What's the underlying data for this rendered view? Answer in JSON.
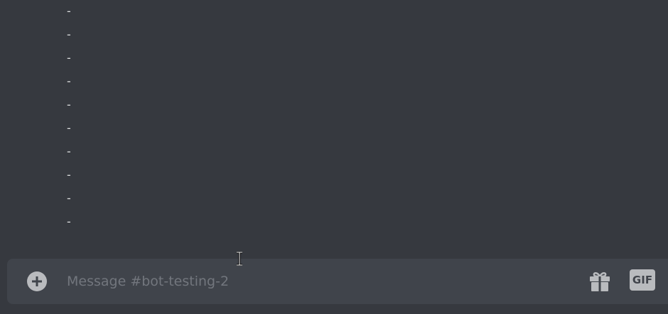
{
  "messages": {
    "lines": [
      "-",
      "-",
      "-",
      "-",
      "-",
      "-",
      "-",
      "-",
      "-",
      "-"
    ]
  },
  "composer": {
    "placeholder": "Message #bot-testing-2",
    "value": "",
    "gif_label": "GIF"
  },
  "icons": {
    "add": "plus-circle-icon",
    "gift": "gift-icon",
    "gif": "gif-icon",
    "cursor": "text-cursor-icon"
  },
  "colors": {
    "background": "#36393f",
    "composer": "#40444b",
    "icon": "#b9bbbe",
    "placeholder": "#72767d",
    "text": "#dcddde"
  }
}
